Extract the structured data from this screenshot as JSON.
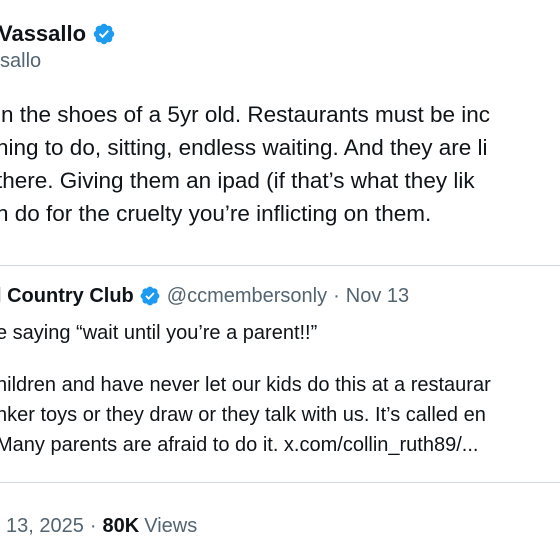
{
  "author": {
    "name": "Vassallo",
    "handle": "sallo",
    "verified_color": "#1d9bf0"
  },
  "tweet": {
    "lines": [
      "in the shoes of a 5yr old. Restaurants must be inc",
      "ning to do, sitting, endless waiting. And they are li",
      "there. Giving them an ipad (if that’s what they lik",
      "n do for the cruelty you’re inflicting on them."
    ]
  },
  "quote": {
    "name": "l Country Club",
    "handle": "@ccmembersonly",
    "separator": "·",
    "date": "Nov 13",
    "lines": [
      "e saying “wait until you’re a parent!!”",
      "",
      "hildren and have never let our kids do this at a restaurar",
      "nker toys or they draw or they talk with us.  It’s called en",
      "Many parents are afraid to do it. x.com/collin_ruth89/..."
    ]
  },
  "meta": {
    "date": "13, 2025",
    "separator": "·",
    "views_count": "80K",
    "views_label": "Views"
  }
}
